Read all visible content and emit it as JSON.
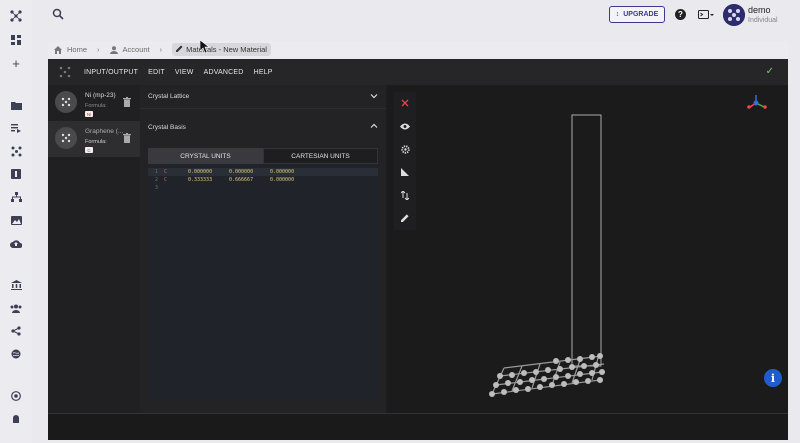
{
  "topbar": {
    "upgrade_label": "UPGRADE",
    "user_name": "demo",
    "user_plan": "Individual"
  },
  "breadcrumb": {
    "home": "Home",
    "account": "Account",
    "current": "Materials - New Material"
  },
  "menubar": {
    "items": [
      "INPUT/OUTPUT",
      "EDIT",
      "VIEW",
      "ADVANCED",
      "HELP"
    ]
  },
  "materials": [
    {
      "name": "Ni (mp-23)",
      "formula_label": "Formula:",
      "formula": "Ni"
    },
    {
      "name": "Graphene (...",
      "formula_label": "Formula:",
      "formula": "C"
    }
  ],
  "editor": {
    "lattice_title": "Crystal Lattice",
    "basis_title": "Crystal Basis",
    "tab_crystal": "CRYSTAL UNITS",
    "tab_cartesian": "CARTESIAN UNITS",
    "rows": [
      {
        "line": "1",
        "element": "C",
        "x": "0.000000",
        "y": "0.000000",
        "z": "0.000000"
      },
      {
        "line": "2",
        "element": "C",
        "x": "0.333333",
        "y": "0.666667",
        "z": "0.000000"
      },
      {
        "line": "3",
        "element": "",
        "x": "",
        "y": "",
        "z": ""
      }
    ]
  },
  "colors": {
    "accent": "#3b3a8f",
    "app_bg": "#1c1c1e",
    "element_red": "#e05a5a",
    "number_yellow": "#d8c77a",
    "success_green": "#7fc36a",
    "info_blue": "#1f5ec9"
  },
  "icons": {
    "rail": [
      "app-logo-icon",
      "dashboard-icon",
      "add-icon",
      "folder-icon",
      "workflows-icon",
      "materials-icon",
      "jobs-icon",
      "projects-icon",
      "images-icon",
      "upload-icon",
      "bank-icon",
      "team-icon",
      "share-icon",
      "explore-icon",
      "dropbox-icon",
      "support-icon"
    ],
    "tools": [
      "close-icon",
      "visibility-icon",
      "settings-icon",
      "measure-icon",
      "sort-icon",
      "edit-icon"
    ]
  }
}
